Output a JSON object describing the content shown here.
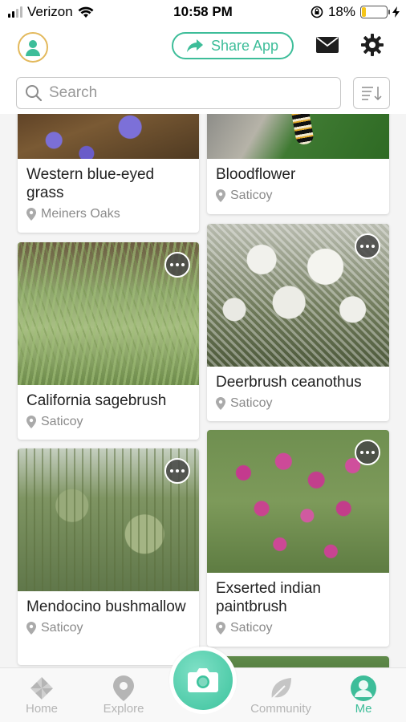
{
  "status_bar": {
    "carrier": "Verizon",
    "time": "10:58 PM",
    "battery_percent": "18%",
    "battery_level": 0.18
  },
  "header": {
    "share_label": "Share App"
  },
  "search": {
    "placeholder": "Search"
  },
  "colors": {
    "accent": "#3dbd99",
    "badge_gold": "#e3b95c"
  },
  "cards": [
    {
      "title": "Western blue-eyed grass",
      "location": "Meiners Oaks"
    },
    {
      "title": "Bloodflower",
      "location": "Saticoy"
    },
    {
      "title": "California sagebrush",
      "location": "Saticoy"
    },
    {
      "title": "Deerbrush ceanothus",
      "location": "Saticoy"
    },
    {
      "title": "Mendocino bushmallow",
      "location": "Saticoy"
    },
    {
      "title": "Exserted indian paintbrush",
      "location": "Saticoy"
    }
  ],
  "tabs": {
    "home": "Home",
    "explore": "Explore",
    "community": "Community",
    "me": "Me"
  }
}
